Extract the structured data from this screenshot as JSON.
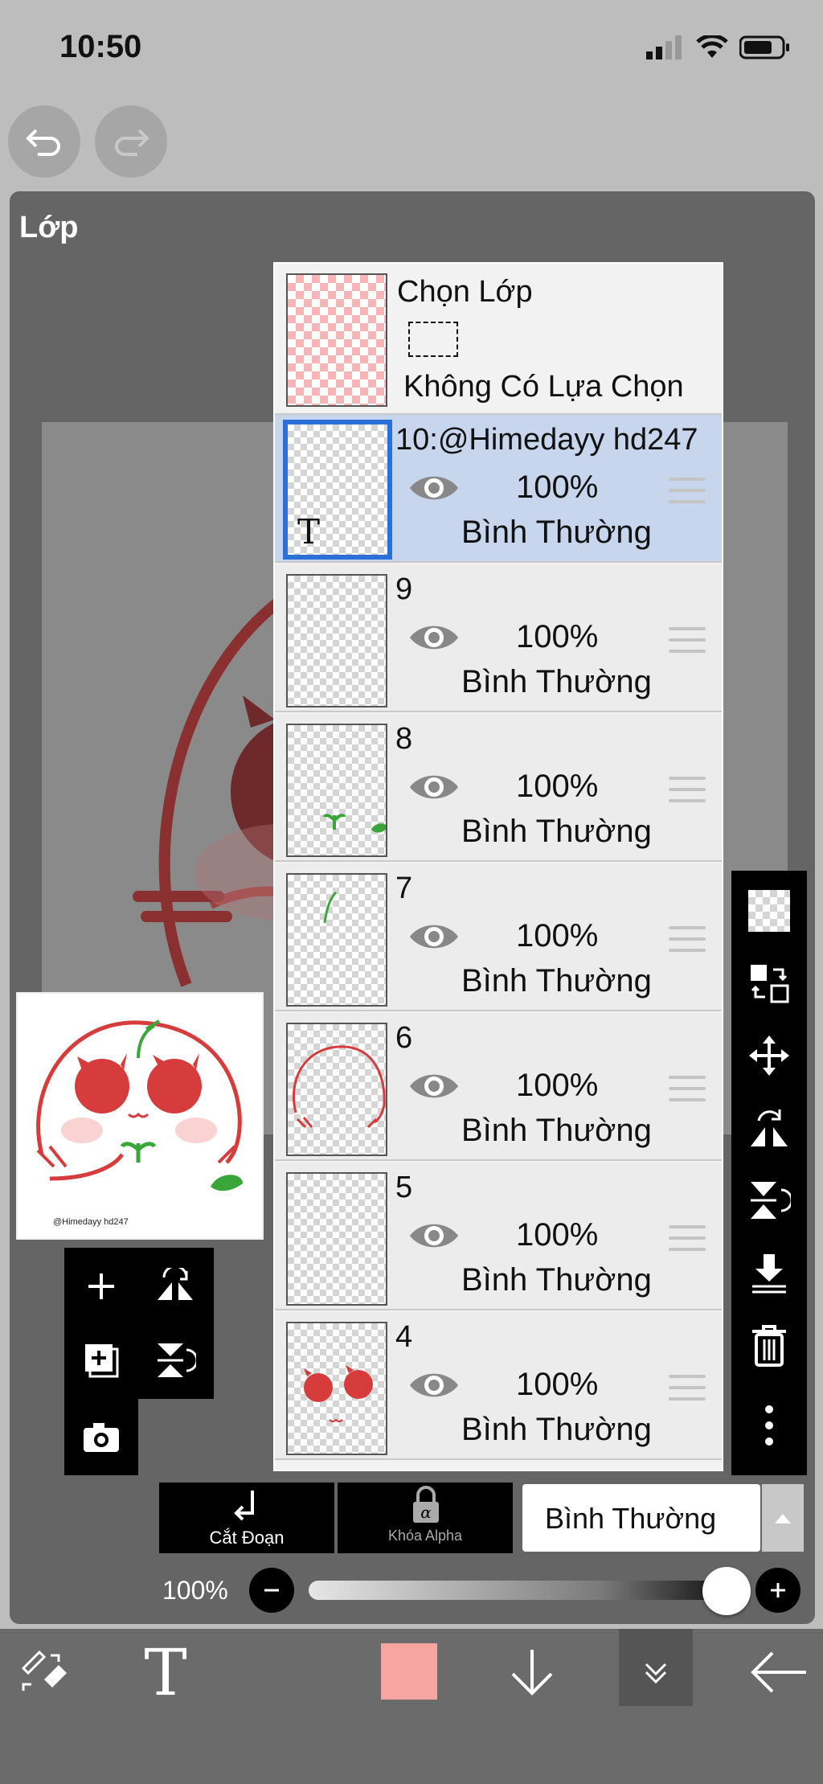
{
  "status": {
    "time": "10:50"
  },
  "dialog": {
    "title": "Lớp"
  },
  "select_layer": {
    "title": "Chọn Lớp",
    "subtitle": "Không Có Lựa Chọn"
  },
  "layers": [
    {
      "name": "10:@Himedayy hd247",
      "opacity": "100%",
      "mode": "Bình Thường",
      "active": true,
      "type": "text"
    },
    {
      "name": "9",
      "opacity": "100%",
      "mode": "Bình Thường"
    },
    {
      "name": "8",
      "opacity": "100%",
      "mode": "Bình Thường"
    },
    {
      "name": "7",
      "opacity": "100%",
      "mode": "Bình Thường"
    },
    {
      "name": "6",
      "opacity": "100%",
      "mode": "Bình Thường"
    },
    {
      "name": "5",
      "opacity": "100%",
      "mode": "Bình Thường"
    },
    {
      "name": "4",
      "opacity": "100%",
      "mode": "Bình Thường"
    }
  ],
  "controls": {
    "clip_label": "Cắt Đoạn",
    "alpha_label": "Khóa Alpha",
    "blend_mode": "Bình Thường",
    "opacity_label": "100%",
    "opacity_value": 1.0
  },
  "thumbnail": {
    "watermark": "@Himedayy hd247"
  },
  "colors": {
    "current_color": "#f6a6a0",
    "active_layer_border": "#2d6fd9",
    "active_layer_bg": "#c7d6ec",
    "drawing_red": "#d63c3c",
    "leaf_green": "#3aa63a"
  },
  "icons": [
    "undo-icon",
    "redo-icon",
    "eye-icon",
    "drag-handle-icon",
    "add-layer-icon",
    "flip-horizontal-icon",
    "duplicate-layer-icon",
    "flip-vertical-icon",
    "camera-icon",
    "transparent-icon",
    "swap-icon",
    "move-icon",
    "rotate-flip-icon",
    "merge-down-icon",
    "trash-icon",
    "more-icon",
    "eraser-icon",
    "text-tool-icon",
    "down-arrow-icon",
    "collapse-icon",
    "back-arrow-icon"
  ]
}
